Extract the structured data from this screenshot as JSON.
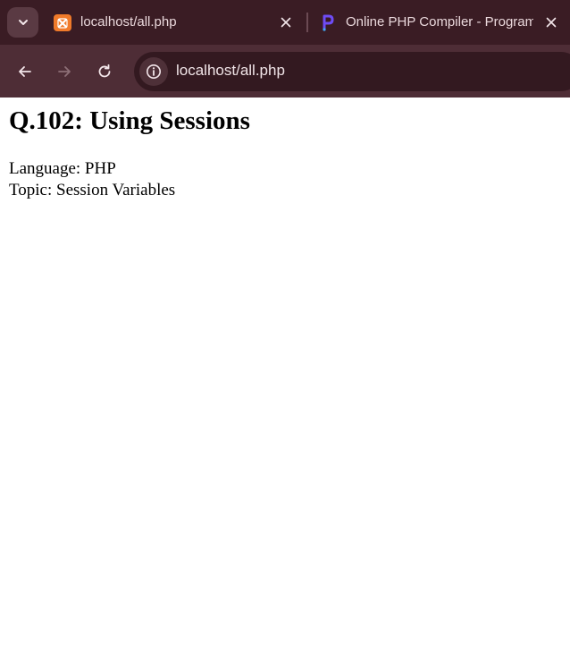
{
  "browser": {
    "tabs": [
      {
        "title": "localhost/all.php",
        "favicon": "xampp-icon",
        "active": true
      },
      {
        "title": "Online PHP Compiler - Programiz",
        "favicon": "programiz-icon",
        "active": false
      }
    ],
    "address_bar": {
      "url": "localhost/all.php"
    },
    "colors": {
      "tabstrip": "#3a1c24",
      "toolbar": "#4e2d36",
      "omnibox": "#331920",
      "xampp_favicon": "#f07a2a"
    }
  },
  "page": {
    "heading": "Q.102: Using Sessions",
    "language_line": "Language: PHP",
    "topic_line": "Topic: Session Variables"
  }
}
